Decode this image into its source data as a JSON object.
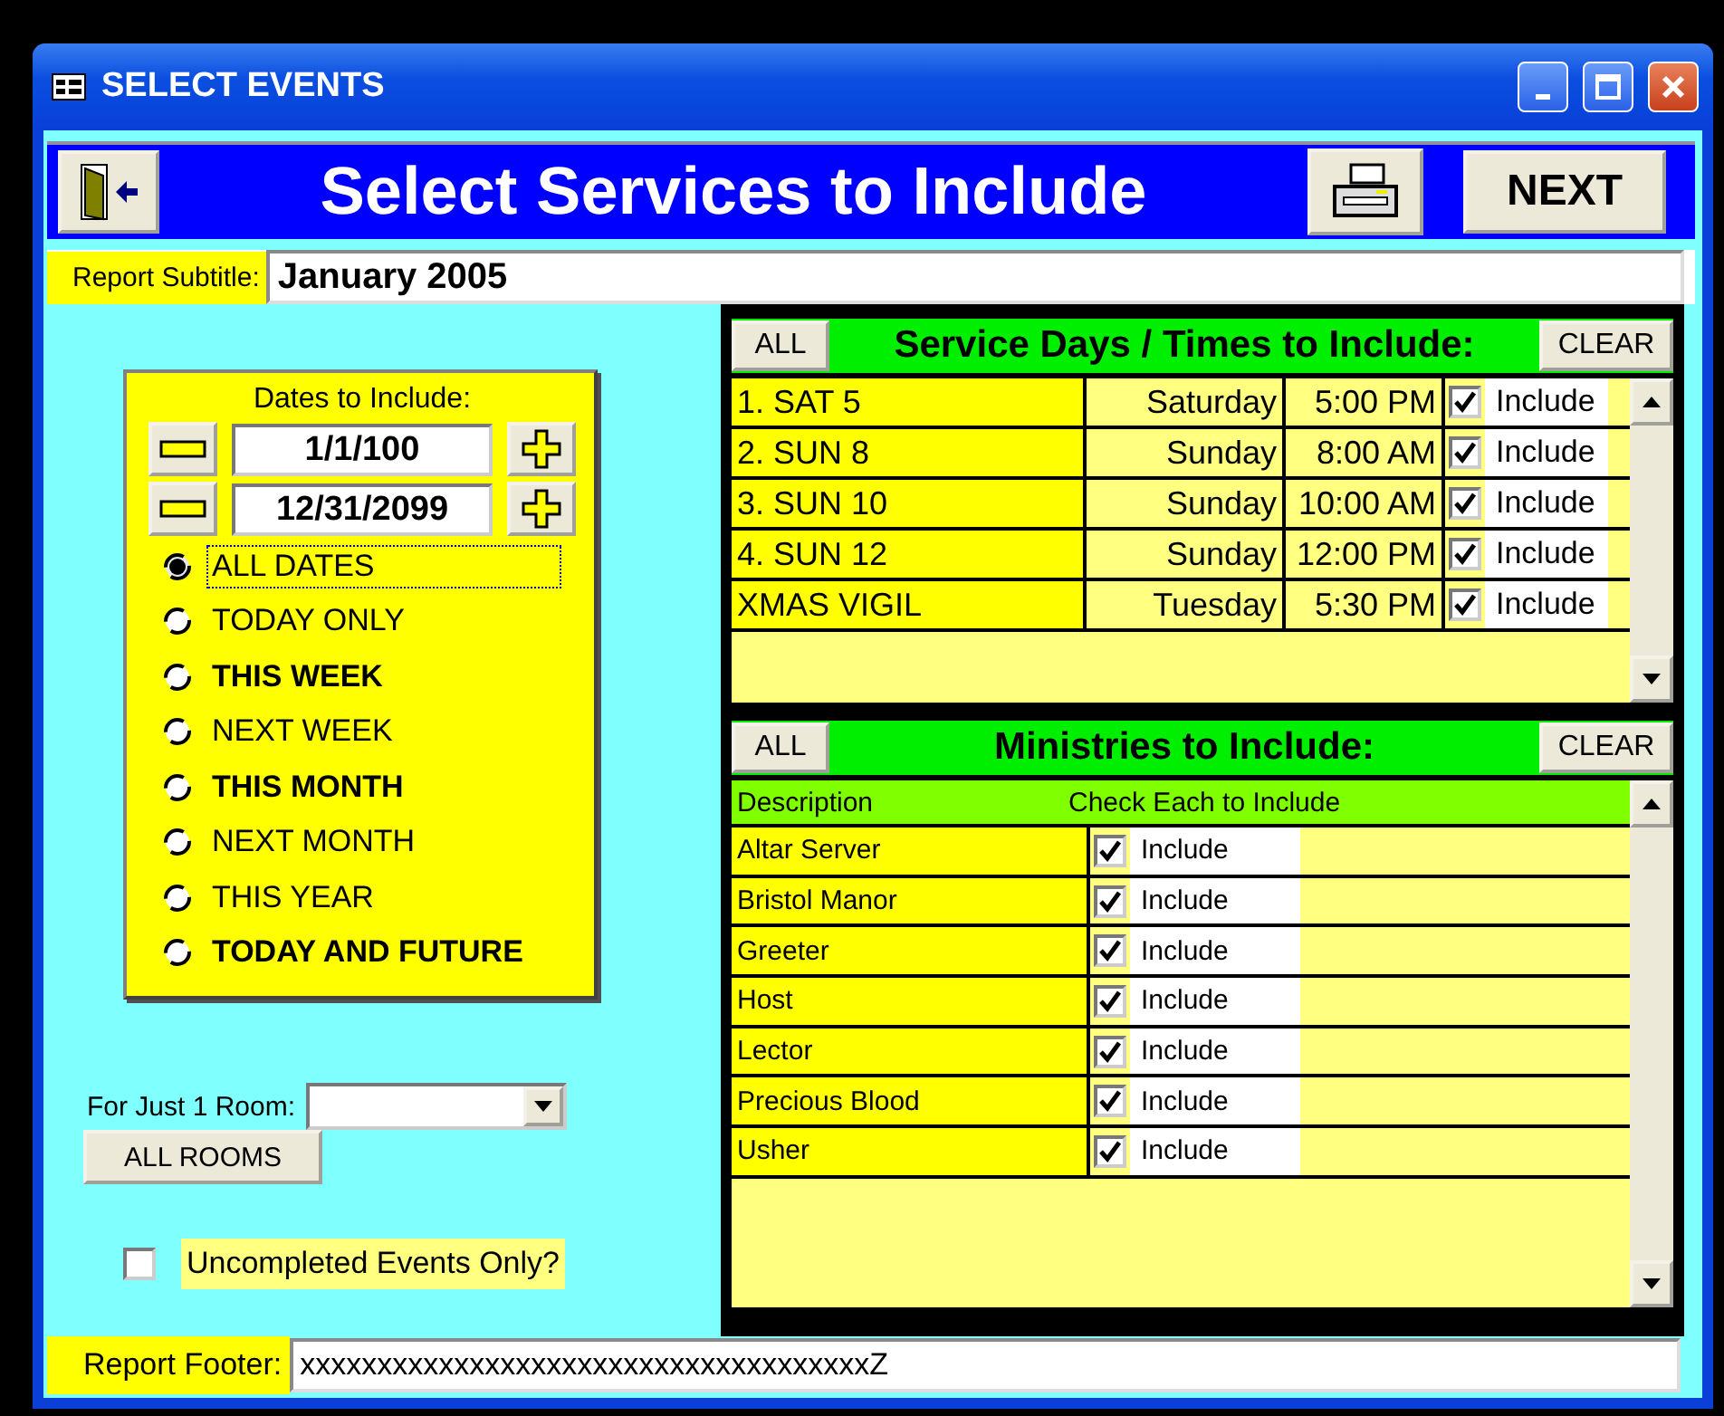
{
  "window": {
    "title": "SELECT EVENTS"
  },
  "header": {
    "title": "Select Services to Include",
    "next_button": "NEXT"
  },
  "subtitle": {
    "label": "Report Subtitle:",
    "value": "January 2005"
  },
  "dates": {
    "label": "Dates to Include:",
    "start": "1/1/100",
    "end": "12/31/2099",
    "options": [
      {
        "label": "ALL DATES",
        "selected": true,
        "bold": false
      },
      {
        "label": "TODAY ONLY",
        "selected": false,
        "bold": false
      },
      {
        "label": "THIS WEEK",
        "selected": false,
        "bold": true
      },
      {
        "label": "NEXT WEEK",
        "selected": false,
        "bold": false
      },
      {
        "label": "THIS MONTH",
        "selected": false,
        "bold": true
      },
      {
        "label": "NEXT MONTH",
        "selected": false,
        "bold": false
      },
      {
        "label": "THIS YEAR",
        "selected": false,
        "bold": false
      },
      {
        "label": "TODAY AND FUTURE",
        "selected": false,
        "bold": true
      }
    ]
  },
  "room": {
    "label": "For Just 1 Room:",
    "all_button": "ALL ROOMS"
  },
  "uncompleted": {
    "label": "Uncompleted Events Only?",
    "checked": false
  },
  "services": {
    "all_button": "ALL",
    "title": "Service Days / Times to Include:",
    "clear_button": "CLEAR",
    "rows": [
      {
        "name": "1.  SAT 5",
        "day": "Saturday",
        "time": "5:00 PM",
        "checked": true,
        "label": "Include"
      },
      {
        "name": "2.  SUN 8",
        "day": "Sunday",
        "time": "8:00 AM",
        "checked": true,
        "label": "Include"
      },
      {
        "name": "3.  SUN 10",
        "day": "Sunday",
        "time": "10:00 AM",
        "checked": true,
        "label": "Include"
      },
      {
        "name": "4.  SUN 12",
        "day": "Sunday",
        "time": "12:00 PM",
        "checked": true,
        "label": "Include"
      },
      {
        "name": "XMAS VIGIL",
        "day": "Tuesday",
        "time": "5:30 PM",
        "checked": true,
        "label": "Include"
      }
    ]
  },
  "ministries": {
    "all_button": "ALL",
    "title": "Ministries to Include:",
    "clear_button": "CLEAR",
    "columns": [
      "Description",
      "Check Each to Include"
    ],
    "rows": [
      {
        "name": "Altar Server",
        "checked": true,
        "label": "Include"
      },
      {
        "name": "Bristol Manor",
        "checked": true,
        "label": "Include"
      },
      {
        "name": "Greeter",
        "checked": true,
        "label": "Include"
      },
      {
        "name": "Host",
        "checked": true,
        "label": "Include"
      },
      {
        "name": "Lector",
        "checked": true,
        "label": "Include"
      },
      {
        "name": "Precious Blood",
        "checked": true,
        "label": "Include"
      },
      {
        "name": "Usher",
        "checked": true,
        "label": "Include"
      }
    ]
  },
  "footer": {
    "label": "Report Footer:",
    "value": "xxxxxxxxxxxxxxxxxxxxxxxxxxxxxxxxxxxxxZ"
  }
}
